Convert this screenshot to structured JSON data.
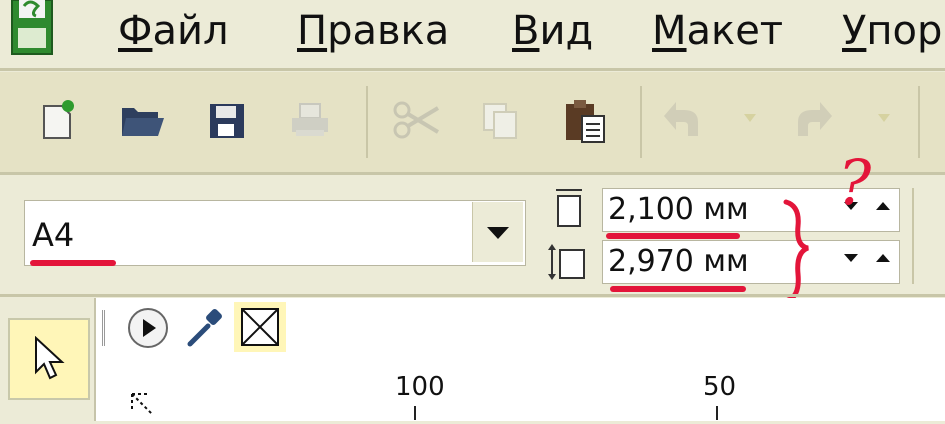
{
  "menu": {
    "items": [
      {
        "accel": "Ф",
        "rest": "айл"
      },
      {
        "accel": "П",
        "rest": "равка"
      },
      {
        "accel": "В",
        "rest": "ид"
      },
      {
        "accel": "М",
        "rest": "акет"
      },
      {
        "accel": "У",
        "rest": "пор"
      }
    ]
  },
  "property_bar": {
    "paper_size": "A4",
    "width_value": "2,100 мм",
    "height_value": "2,970 мм"
  },
  "ruler": {
    "labels": [
      "100",
      "50"
    ]
  },
  "annotation": {
    "mark": "?",
    "color": "#E3153A"
  },
  "icons": [
    "app-icon",
    "new-document-icon",
    "open-folder-icon",
    "save-icon",
    "print-icon",
    "cut-icon",
    "copy-icon",
    "paste-icon",
    "undo-icon",
    "redo-icon",
    "width-icon",
    "height-icon",
    "play-icon",
    "eyedropper-icon",
    "no-fill-icon",
    "pointer-tool-icon"
  ]
}
